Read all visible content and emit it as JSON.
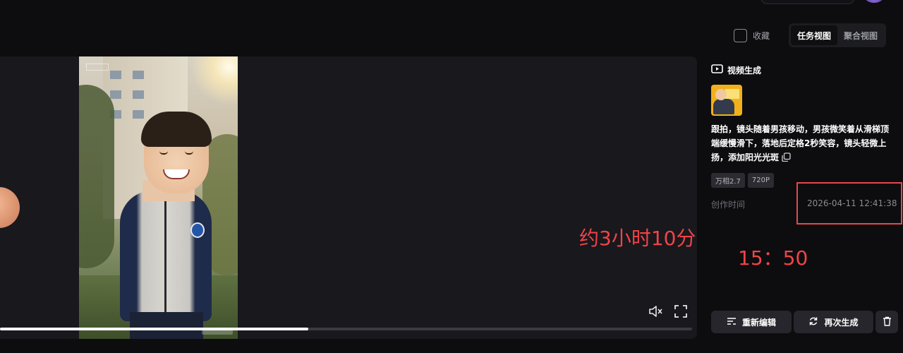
{
  "header": {
    "favorite_label": "收藏",
    "view_tabs": [
      {
        "label": "任务视图",
        "active": true
      },
      {
        "label": "聚合视图",
        "active": false
      }
    ]
  },
  "player": {
    "progress": 0.445,
    "icons": [
      "mute-icon",
      "fullscreen-icon"
    ]
  },
  "details": {
    "section_title": "视频生成",
    "section_icon": "video-play-icon",
    "prompt": "跟拍，镜头随着男孩移动，男孩微笑着从滑梯顶端缓慢滑下，落地后定格2秒笑容，镜头轻微上扬，添加阳光光斑",
    "tags": [
      "万相2.7",
      "720P"
    ],
    "created_label": "创作时间",
    "created_value": "2026-04-11 12:41:38"
  },
  "actions": {
    "reedit_label": "重新编辑",
    "regenerate_label": "再次生成"
  },
  "annotations": {
    "duration": "约3小时10分",
    "clock": "15：50",
    "highlight_color": "#e5484d"
  },
  "colors": {
    "background": "#0d0d0f",
    "panel": "#18181d",
    "button": "#26262c",
    "annotation": "#ef4448"
  }
}
